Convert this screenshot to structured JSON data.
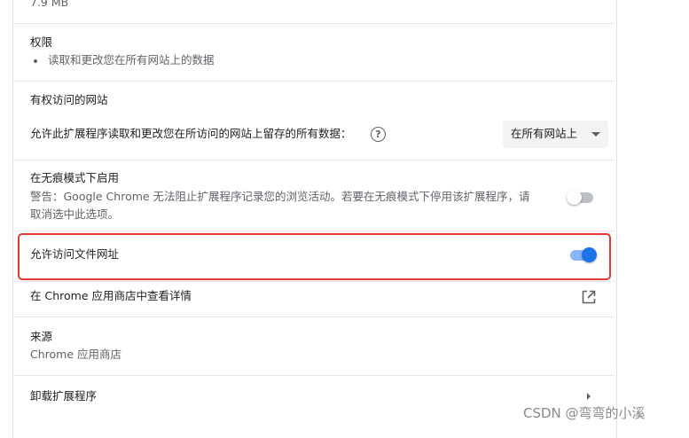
{
  "size": {
    "value": "7.9 MB"
  },
  "permissions": {
    "title": "权限",
    "items": [
      "读取和更改您在所有网站上的数据"
    ]
  },
  "site_access": {
    "title": "有权访问的网站",
    "description": "允许此扩展程序读取和更改您在所访问的网站上留存的所有数据：",
    "help_icon": "help-circle-icon",
    "select_value": "在所有网站上"
  },
  "incognito": {
    "title": "在无痕模式下启用",
    "warning_line1": "警告：Google Chrome 无法阻止扩展程序记录您的浏览活动。若要在无痕模式下停用该扩展程序，请",
    "warning_line2": "取消选中此选项。",
    "enabled": false
  },
  "file_urls": {
    "label": "允许访问文件网址",
    "enabled": true,
    "highlight_color": "#e53935"
  },
  "store_link": {
    "label": "在 Chrome 应用商店中查看详情",
    "icon": "open-in-new-icon"
  },
  "source": {
    "title": "来源",
    "value": "Chrome 应用商店"
  },
  "uninstall": {
    "label": "卸载扩展程序",
    "icon": "chevron-right-icon"
  },
  "watermark": "CSDN @弯弯的小溪",
  "colors": {
    "accent": "#1a73e8",
    "accent_light": "#8ab4f8",
    "toggle_off": "#bdc1c6",
    "text": "#202124",
    "secondary_text": "#5f6368"
  }
}
